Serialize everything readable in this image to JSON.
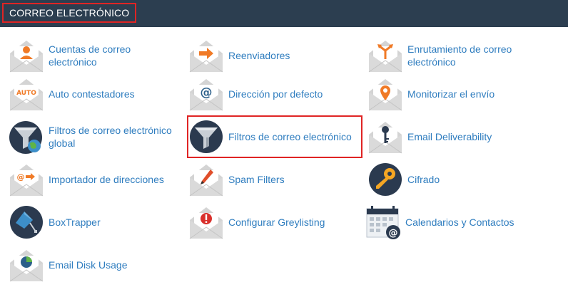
{
  "header": {
    "title": "CORREO ELECTRÓNICO"
  },
  "colors": {
    "header_bg": "#2c3e50",
    "link": "#2f7dbf",
    "highlight": "#e02424",
    "accent_orange": "#f07a26",
    "envelope": "#d9d9d9",
    "dark_circle": "#2b3a4f"
  },
  "items": [
    {
      "label": "Cuentas de correo electrónico",
      "icon": "user-envelope-icon"
    },
    {
      "label": "Reenviadores",
      "icon": "forward-arrow-envelope-icon"
    },
    {
      "label": "Enrutamiento de correo electrónico",
      "icon": "routing-envelope-icon"
    },
    {
      "label": "Auto contestadores",
      "icon": "auto-envelope-icon",
      "badge": "AUTO"
    },
    {
      "label": "Dirección por defecto",
      "icon": "at-envelope-icon"
    },
    {
      "label": "Monitorizar el envío",
      "icon": "location-pin-envelope-icon"
    },
    {
      "label": "Filtros de correo electrónico global",
      "icon": "global-filter-icon"
    },
    {
      "label": "Filtros de correo electrónico",
      "icon": "filter-funnel-icon"
    },
    {
      "label": "Email Deliverability",
      "icon": "key-envelope-icon"
    },
    {
      "label": "Importador de direcciones",
      "icon": "import-envelope-icon"
    },
    {
      "label": "Spam Filters",
      "icon": "pencil-envelope-icon"
    },
    {
      "label": "Cifrado",
      "icon": "encryption-key-icon"
    },
    {
      "label": "BoxTrapper",
      "icon": "boxtrapper-icon"
    },
    {
      "label": "Configurar Greylisting",
      "icon": "warning-envelope-icon"
    },
    {
      "label": "Calendarios y Contactos",
      "icon": "calendar-contacts-icon"
    },
    {
      "label": "Email Disk Usage",
      "icon": "pie-chart-envelope-icon"
    }
  ]
}
